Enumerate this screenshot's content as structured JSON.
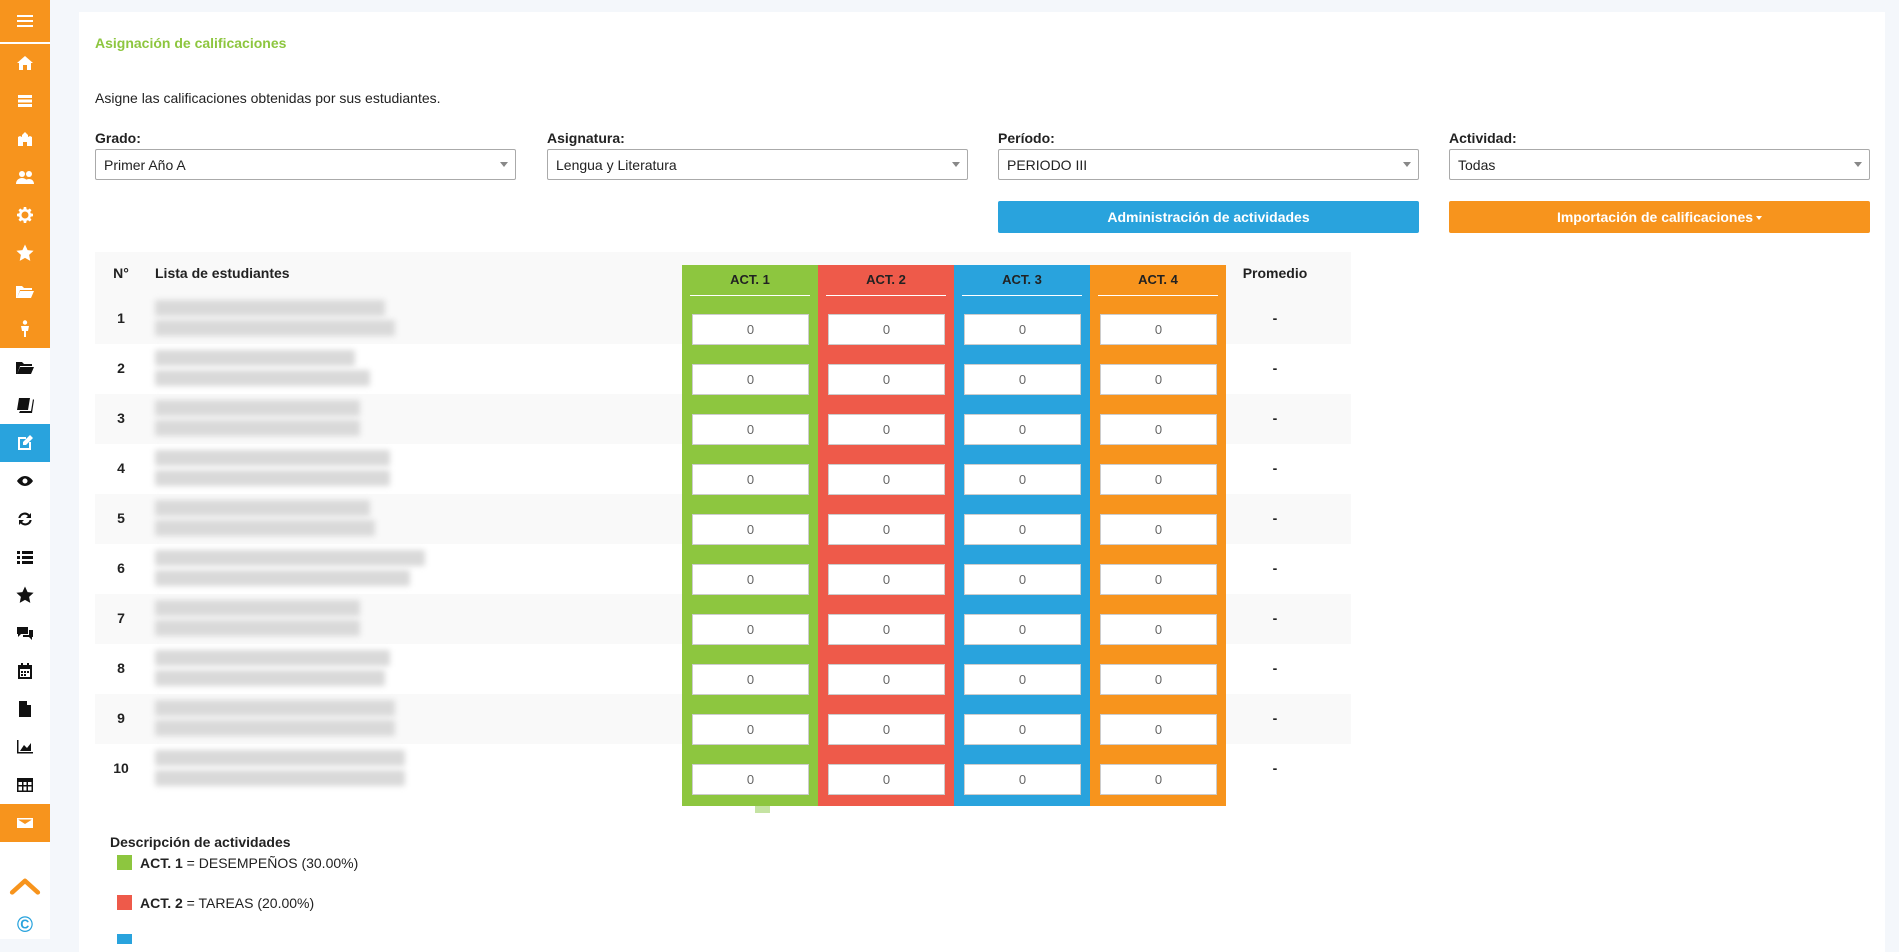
{
  "app": {
    "accent_orange": "#f7941d",
    "accent_blue": "#29a3dd",
    "accent_green": "#8dc63f",
    "accent_red": "#ee5a4a"
  },
  "sidebar": {
    "items": [
      {
        "icon": "menu-icon"
      },
      {
        "icon": "home-icon"
      },
      {
        "icon": "list-icon"
      },
      {
        "icon": "castle-icon"
      },
      {
        "icon": "users-icon"
      },
      {
        "icon": "gear-icon"
      },
      {
        "icon": "star-icon"
      },
      {
        "icon": "folder-open-icon"
      },
      {
        "icon": "person-icon"
      },
      {
        "icon": "folder-open-icon"
      },
      {
        "icon": "book-icon"
      },
      {
        "icon": "edit-icon"
      },
      {
        "icon": "eye-icon"
      },
      {
        "icon": "refresh-icon"
      },
      {
        "icon": "list-bullet-icon"
      },
      {
        "icon": "star-icon"
      },
      {
        "icon": "comments-icon"
      },
      {
        "icon": "calendar-icon"
      },
      {
        "icon": "file-icon"
      },
      {
        "icon": "chart-area-icon"
      },
      {
        "icon": "table-icon"
      },
      {
        "icon": "envelope-icon"
      }
    ],
    "copyright": "©"
  },
  "page": {
    "title": "Asignación de calificaciones",
    "description": "Asigne las calificaciones obtenidas por sus estudiantes."
  },
  "filters": {
    "grado": {
      "label": "Grado:",
      "value": "Primer Año A"
    },
    "asignatura": {
      "label": "Asignatura:",
      "value": "Lengua y Literatura"
    },
    "periodo": {
      "label": "Período:",
      "value": "PERIODO III"
    },
    "actividad": {
      "label": "Actividad:",
      "value": "Todas"
    }
  },
  "buttons": {
    "admin_actividades": "Administración de actividades",
    "importacion": "Importación de calificaciones"
  },
  "table": {
    "headers": {
      "n": "N°",
      "students": "Lista de estudiantes",
      "average": "Promedio"
    },
    "activities": [
      {
        "label": "ACT. 1",
        "color": "#8dc63f"
      },
      {
        "label": "ACT. 2",
        "color": "#ee5a4a"
      },
      {
        "label": "ACT. 3",
        "color": "#29a3dd"
      },
      {
        "label": "ACT. 4",
        "color": "#f7941d"
      }
    ],
    "rows": [
      {
        "n": "1",
        "grades": [
          "0",
          "0",
          "0",
          "0"
        ],
        "average": "-"
      },
      {
        "n": "2",
        "grades": [
          "0",
          "0",
          "0",
          "0"
        ],
        "average": "-"
      },
      {
        "n": "3",
        "grades": [
          "0",
          "0",
          "0",
          "0"
        ],
        "average": "-"
      },
      {
        "n": "4",
        "grades": [
          "0",
          "0",
          "0",
          "0"
        ],
        "average": "-"
      },
      {
        "n": "5",
        "grades": [
          "0",
          "0",
          "0",
          "0"
        ],
        "average": "-"
      },
      {
        "n": "6",
        "grades": [
          "0",
          "0",
          "0",
          "0"
        ],
        "average": "-"
      },
      {
        "n": "7",
        "grades": [
          "0",
          "0",
          "0",
          "0"
        ],
        "average": "-"
      },
      {
        "n": "8",
        "grades": [
          "0",
          "0",
          "0",
          "0"
        ],
        "average": "-"
      },
      {
        "n": "9",
        "grades": [
          "0",
          "0",
          "0",
          "0"
        ],
        "average": "-"
      },
      {
        "n": "10",
        "grades": [
          "0",
          "0",
          "0",
          "0"
        ],
        "average": "-"
      }
    ]
  },
  "legend": {
    "title": "Descripción de actividades",
    "items": [
      {
        "code": "ACT. 1",
        "desc": " = DESEMPEÑOS (30.00%)",
        "color": "#8dc63f"
      },
      {
        "code": "ACT. 2",
        "desc": " = TAREAS (20.00%)",
        "color": "#ee5a4a"
      }
    ]
  }
}
